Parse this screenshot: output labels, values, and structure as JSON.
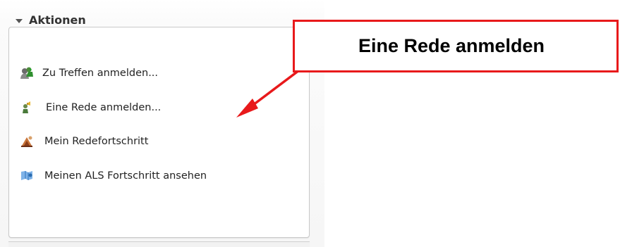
{
  "panel": {
    "title": "Aktionen",
    "items": [
      {
        "label": "Zu Treffen anmelden...",
        "icon": "meeting-signup-icon"
      },
      {
        "label": "Eine Rede anmelden...",
        "icon": "speech-signup-icon"
      },
      {
        "label": "Mein Redefortschritt",
        "icon": "speech-progress-icon"
      },
      {
        "label": "Meinen ALS Fortschritt ansehen",
        "icon": "als-progress-icon"
      }
    ]
  },
  "annotation": {
    "text": "Eine Rede anmelden",
    "color": "#e8191b"
  }
}
